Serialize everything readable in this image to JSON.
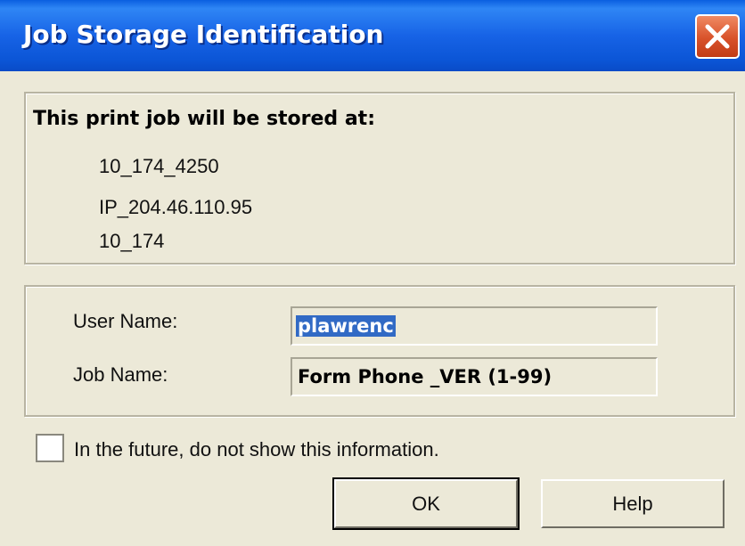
{
  "window": {
    "title": "Job Storage Identification",
    "close_icon": "close-icon"
  },
  "storage_info": {
    "heading": "This print job will be stored at:",
    "lines": [
      "10_174_4250",
      "IP_204.46.110.95",
      "10_174"
    ]
  },
  "fields": {
    "user_name": {
      "label": "User Name:",
      "value": "plawrenc",
      "selected": true
    },
    "job_name": {
      "label": "Job Name:",
      "value": "Form Phone _VER (1-99)"
    }
  },
  "options": {
    "dont_show_label": "In the future, do not show this information.",
    "dont_show_checked": false
  },
  "buttons": {
    "ok_label": "OK",
    "help_label": "Help"
  },
  "colors": {
    "titlebar": "#0b55d6",
    "close_button": "#d8522a",
    "dialog_background": "#ece9d8",
    "selection": "#316ac5"
  }
}
